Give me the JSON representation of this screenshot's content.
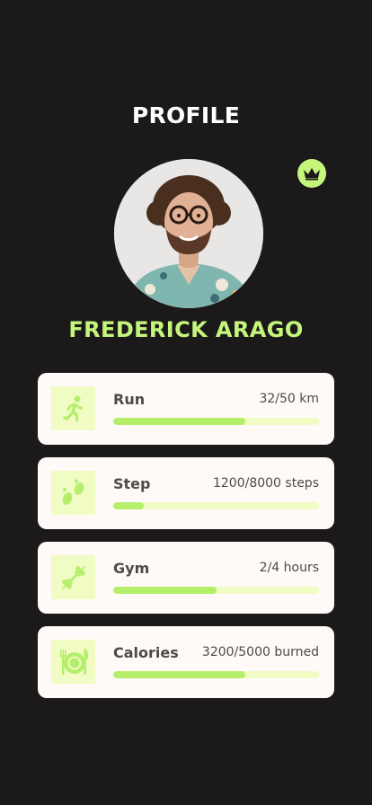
{
  "header": {
    "title": "PROFILE"
  },
  "profile": {
    "name": "FREDERICK ARAGO"
  },
  "colors": {
    "background": "#1b1919",
    "accent": "#c5f57a",
    "bar_fill": "#b4ef6c",
    "bar_track": "#f1fbc4"
  },
  "stats": [
    {
      "label": "Run",
      "value": "32/50 km",
      "progress": 0.64,
      "icon": "running-icon"
    },
    {
      "label": "Step",
      "value": "1200/8000 steps",
      "progress": 0.15,
      "icon": "footsteps-icon"
    },
    {
      "label": "Gym",
      "value": "2/4 hours",
      "progress": 0.5,
      "icon": "dumbbell-icon"
    },
    {
      "label": "Calories",
      "value": "3200/5000 burned",
      "progress": 0.64,
      "icon": "plate-cutlery-icon"
    }
  ]
}
